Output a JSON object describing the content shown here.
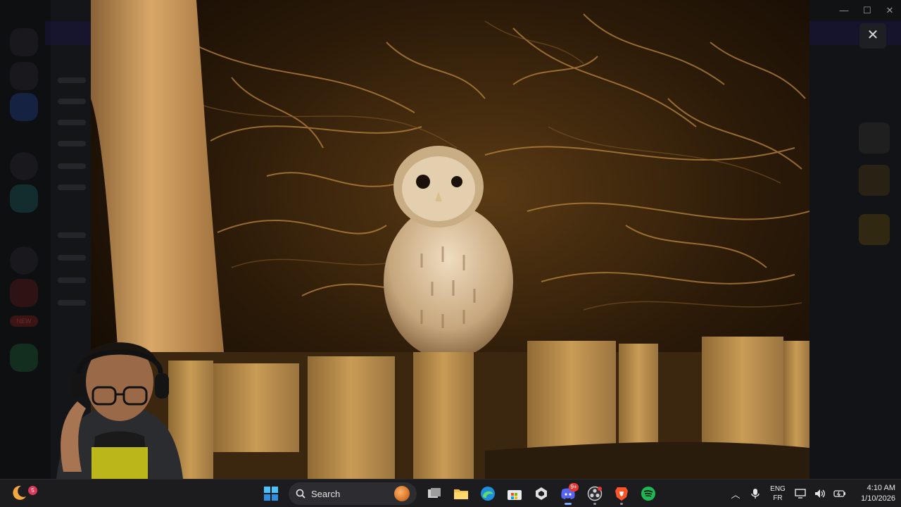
{
  "background_app": {
    "new_badge": "NEW"
  },
  "window_controls": {
    "minimize": "—",
    "maximize": "☐",
    "close": "✕"
  },
  "viewer": {
    "close_label": "✕"
  },
  "taskbar": {
    "weather_badge": "5",
    "search_label": "Search",
    "discord_badge": "9+",
    "apps": [
      "start-icon",
      "task-view-icon",
      "file-explorer-icon",
      "edge-icon",
      "store-icon",
      "unity-icon",
      "discord-icon",
      "obs-icon",
      "brave-icon",
      "spotify-icon"
    ],
    "lang_primary": "ENG",
    "lang_secondary": "FR",
    "time": "4:10 AM",
    "date": "1/10/2026"
  },
  "colors": {
    "taskbar_bg": "#1c1c1f",
    "accent": "#7aa8ff",
    "discord": "#5865f2",
    "spotify": "#1db954",
    "brave": "#fb542b"
  }
}
